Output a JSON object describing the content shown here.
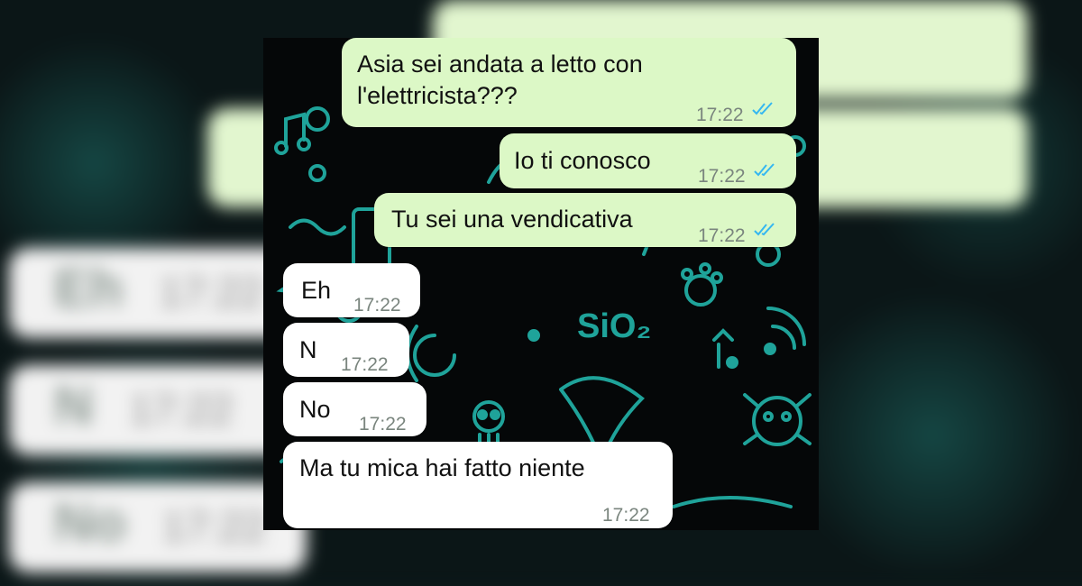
{
  "colors": {
    "outgoing_bubble": "#dcf8c6",
    "incoming_bubble": "#ffffff",
    "chat_background": "#050708",
    "wallpaper_doodle": "#1fa39a",
    "read_ticks": "#34b7f1"
  },
  "chat": {
    "messages": [
      {
        "direction": "outgoing",
        "text": "Asia sei andata a letto con l'elettricista???",
        "time": "17:22",
        "status": "read"
      },
      {
        "direction": "outgoing",
        "text": "Io ti conosco",
        "time": "17:22",
        "status": "read"
      },
      {
        "direction": "outgoing",
        "text": "Tu sei una vendicativa",
        "time": "17:22",
        "status": "read"
      },
      {
        "direction": "incoming",
        "text": "Eh",
        "time": "17:22"
      },
      {
        "direction": "incoming",
        "text": "N",
        "time": "17:22"
      },
      {
        "direction": "incoming",
        "text": "No",
        "time": "17:22"
      },
      {
        "direction": "incoming",
        "text": "Ma tu mica hai fatto niente",
        "time": "17:22"
      }
    ],
    "wallpaper_text": "SiO₂"
  },
  "backdrop": {
    "left_bubbles": [
      "Eh",
      "N",
      "No"
    ],
    "time": "17:22"
  }
}
